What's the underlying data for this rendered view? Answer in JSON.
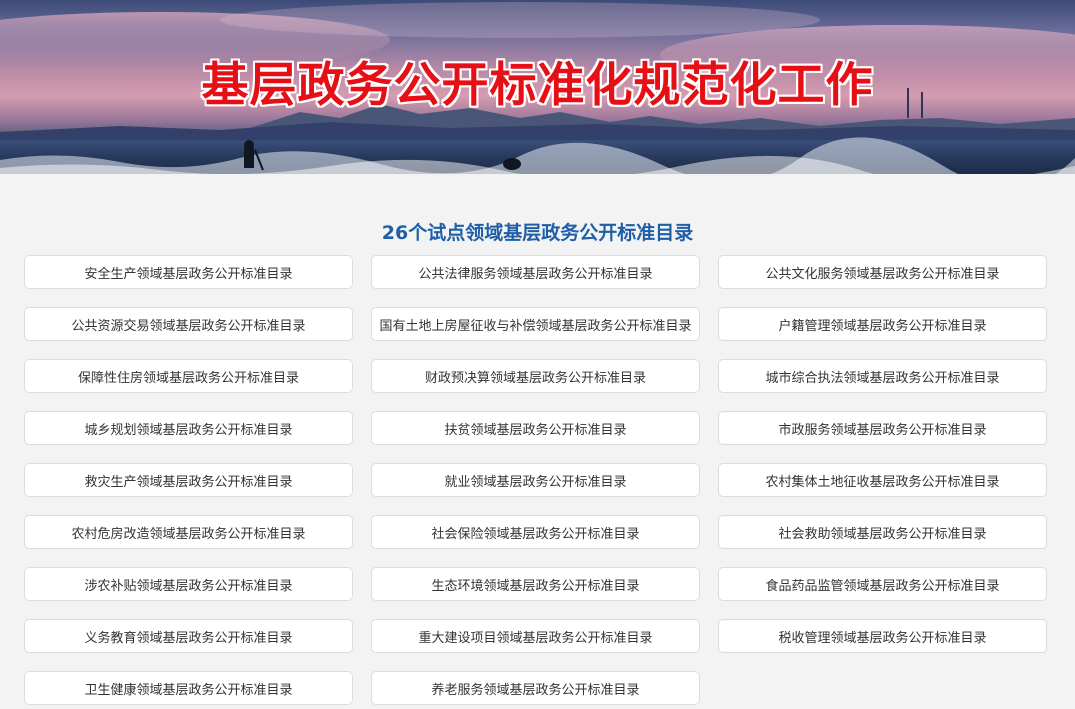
{
  "banner": {
    "title": "基层政务公开标准化规范化工作"
  },
  "main": {
    "section_title": "26个试点领域基层政务公开标准目录",
    "items": [
      {
        "label": "安全生产领域基层政务公开标准目录"
      },
      {
        "label": "公共法律服务领域基层政务公开标准目录"
      },
      {
        "label": "公共文化服务领域基层政务公开标准目录"
      },
      {
        "label": "公共资源交易领域基层政务公开标准目录"
      },
      {
        "label": "国有土地上房屋征收与补偿领域基层政务公开标准目录"
      },
      {
        "label": "户籍管理领域基层政务公开标准目录"
      },
      {
        "label": "保障性住房领域基层政务公开标准目录"
      },
      {
        "label": "财政预决算领域基层政务公开标准目录"
      },
      {
        "label": "城市综合执法领域基层政务公开标准目录"
      },
      {
        "label": "城乡规划领域基层政务公开标准目录"
      },
      {
        "label": "扶贫领域基层政务公开标准目录"
      },
      {
        "label": "市政服务领域基层政务公开标准目录"
      },
      {
        "label": "救灾生产领域基层政务公开标准目录"
      },
      {
        "label": "就业领域基层政务公开标准目录"
      },
      {
        "label": "农村集体土地征收基层政务公开标准目录"
      },
      {
        "label": "农村危房改造领域基层政务公开标准目录"
      },
      {
        "label": "社会保险领域基层政务公开标准目录"
      },
      {
        "label": "社会救助领域基层政务公开标准目录"
      },
      {
        "label": "涉农补贴领域基层政务公开标准目录"
      },
      {
        "label": "生态环境领域基层政务公开标准目录"
      },
      {
        "label": "食品药品监管领域基层政务公开标准目录"
      },
      {
        "label": "义务教育领域基层政务公开标准目录"
      },
      {
        "label": "重大建设项目领域基层政务公开标准目录"
      },
      {
        "label": "税收管理领域基层政务公开标准目录"
      },
      {
        "label": "卫生健康领域基层政务公开标准目录"
      },
      {
        "label": "养老服务领域基层政务公开标准目录"
      }
    ]
  },
  "colors": {
    "title_red": "#e60f16",
    "section_blue": "#1f5fa8",
    "page_bg": "#f3f3f3",
    "card_border": "#dcdcdc"
  }
}
